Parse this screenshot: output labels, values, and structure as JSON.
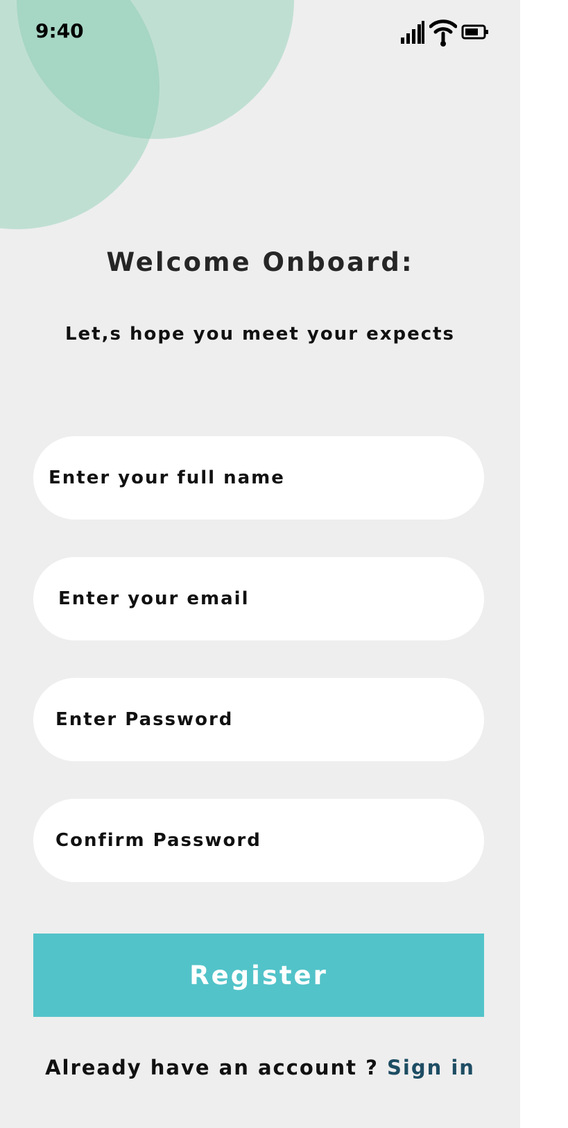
{
  "status_bar": {
    "time": "9:40",
    "icons": [
      "cellular-signal-icon",
      "wifi-icon",
      "battery-icon"
    ]
  },
  "colors": {
    "background": "#eeeeee",
    "decor_circles": "#88ccb2",
    "register_button": "#52c3c9",
    "sign_in_link": "#1d4d63"
  },
  "header": {
    "title": "Welcome Onboard:",
    "subtitle": "Let,s hope you meet your expects"
  },
  "form": {
    "full_name": {
      "placeholder": "Enter your full name",
      "value": ""
    },
    "email": {
      "placeholder": "Enter your email",
      "value": ""
    },
    "password": {
      "placeholder": "Enter Password",
      "value": ""
    },
    "confirm_password": {
      "placeholder": "Confirm Password",
      "value": ""
    },
    "register_label": "Register"
  },
  "footer": {
    "prompt": "Already have an account ? ",
    "sign_in_label": "Sign in"
  }
}
